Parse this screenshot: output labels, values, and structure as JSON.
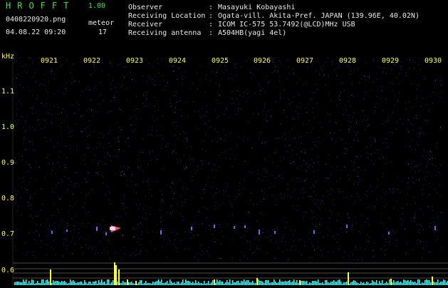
{
  "header": {
    "title": "HROFFT",
    "version": "1.00",
    "filename": "0408220920.png",
    "meteor_label": "meteor",
    "datetime": "04.08.22 09:20",
    "meteor_count": "17"
  },
  "info": [
    {
      "label": "Observer",
      "value": "Masayuki Kobayashi"
    },
    {
      "label": "Receiving Location",
      "value": "Ogata-vill. Akita-Pref. JAPAN (139.96E, 40.02N)"
    },
    {
      "label": "Receiver",
      "value": "ICOM IC-575 53.7492(@LCD)MHz USB"
    },
    {
      "label": "Receiving antenna",
      "value": "A504HB(yagi 4el)"
    }
  ],
  "separator": ":",
  "axis": {
    "unit": "kHz",
    "y_ticks": [
      "1.1",
      "1.0",
      "0.9",
      "0.8",
      "0.7",
      "0.6"
    ],
    "x_ticks": [
      "0921",
      "0922",
      "0923",
      "0924",
      "0925",
      "0926",
      "0927",
      "0928",
      "0929",
      "0930"
    ]
  },
  "colors": {
    "background": "#000000",
    "noise": "#2a2aa0",
    "signal": "#ff3366",
    "text_green": "#33e833",
    "text_yellow": "#ffff33",
    "text_white": "#eaeaea",
    "bar": "#ffff33",
    "bar_low": "#33ffff"
  }
}
